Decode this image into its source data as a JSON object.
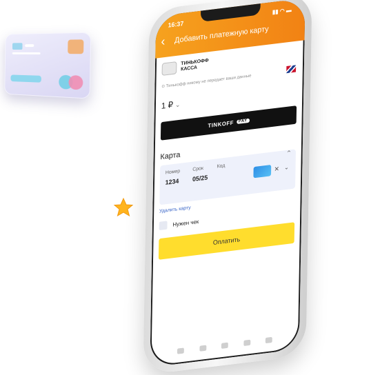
{
  "status_bar": {
    "time": "16:37",
    "icons": "▮▮ ◠ ▬"
  },
  "header": {
    "back_icon": "back-arrow-icon",
    "title": "Добавить платежную карту",
    "color_start": "#f6a21e",
    "color_end": "#f28214"
  },
  "merchant": {
    "logo_line1": "ТИНЬКОФФ",
    "logo_line2": "КАССА"
  },
  "notice": "Тинькофф никому не передает ваши данные",
  "language_flag": "uk-flag-icon",
  "amount": {
    "value": "1 ₽"
  },
  "tinkoff_pay": {
    "label": "TINKOFF",
    "badge": "PAY"
  },
  "card_section": {
    "title": "Карта",
    "fields": [
      {
        "label": "Номер",
        "value": "1234"
      },
      {
        "label": "Срок",
        "value": "05/25"
      },
      {
        "label": "Код",
        "value": ""
      }
    ],
    "delete_link": "Удалить карту"
  },
  "receipt": {
    "label": "Нужен чек"
  },
  "submit": {
    "label": "Оплатить",
    "color": "#ffdd2d"
  }
}
